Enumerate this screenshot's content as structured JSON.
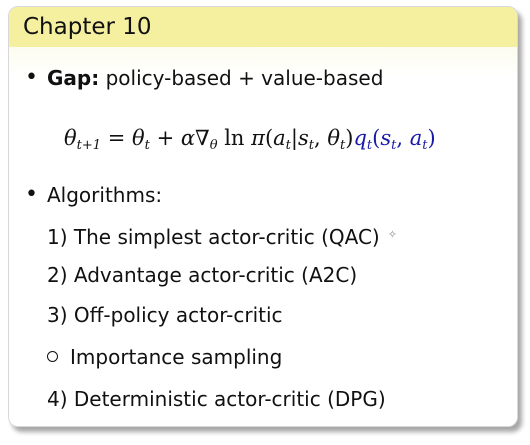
{
  "header": {
    "title": "Chapter 10"
  },
  "gap": {
    "label": "Gap:",
    "text": "policy-based + value-based"
  },
  "formula": {
    "theta": "θ",
    "sub_t1": "t+1",
    "eq": " = ",
    "sub_t": "t",
    "plus": " + ",
    "alpha": "α",
    "nabla": "∇",
    "ln": " ln ",
    "pi": "π",
    "q": "q"
  },
  "algorithms": {
    "label": "Algorithms:",
    "items": [
      "1) The simplest actor-critic (QAC)",
      "2) Advantage actor-critic (A2C)",
      "3) Off-policy actor-critic",
      "Importance sampling",
      "4) Deterministic actor-critic (DPG)"
    ]
  }
}
